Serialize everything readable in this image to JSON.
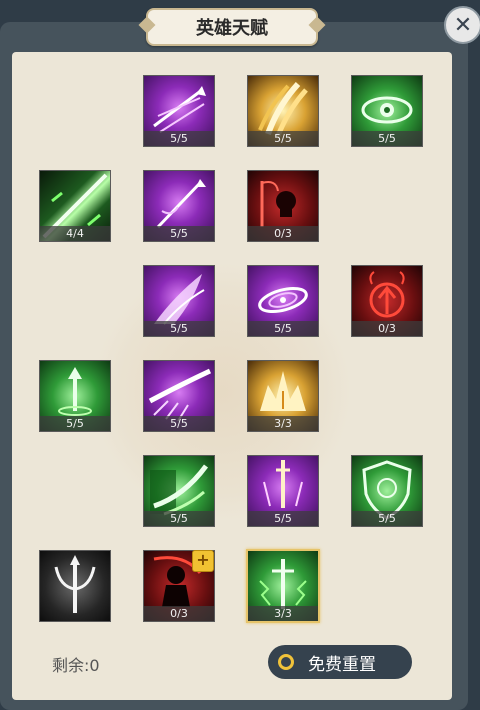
{
  "header": {
    "title": "英雄天赋"
  },
  "close_icon": "close-icon",
  "talents": [
    {
      "id": "arrows-volley",
      "count": "5/5",
      "color": "purple",
      "icon": "triple-arrow-icon"
    },
    {
      "id": "golden-claws",
      "count": "5/5",
      "color": "gold",
      "icon": "claw-slash-icon"
    },
    {
      "id": "green-eye",
      "count": "5/5",
      "color": "green",
      "icon": "eye-icon"
    },
    {
      "id": "green-blade-storm",
      "count": "4/4",
      "color": "green",
      "icon": "blade-storm-icon"
    },
    {
      "id": "spirit-arrow",
      "count": "5/5",
      "color": "purple",
      "icon": "spirit-arrow-icon"
    },
    {
      "id": "skull-sickle",
      "count": "0/3",
      "color": "red",
      "icon": "skull-sickle-icon"
    },
    {
      "id": "purple-wing",
      "count": "5/5",
      "color": "purple",
      "icon": "wing-icon"
    },
    {
      "id": "void-vortex",
      "count": "5/5",
      "color": "purple",
      "icon": "vortex-icon"
    },
    {
      "id": "demon-sigil",
      "count": "0/3",
      "color": "red",
      "icon": "demon-sigil-icon"
    },
    {
      "id": "nature-arrow",
      "count": "5/5",
      "color": "green",
      "icon": "ground-arrow-icon"
    },
    {
      "id": "purple-slash",
      "count": "5/5",
      "color": "purple",
      "icon": "slash-icon"
    },
    {
      "id": "golden-crown",
      "count": "3/3",
      "color": "gold",
      "icon": "crown-burst-icon"
    },
    {
      "id": "scale-claw",
      "count": "5/5",
      "color": "green",
      "icon": "scale-claw-icon"
    },
    {
      "id": "sword-rain",
      "count": "5/5",
      "color": "purple",
      "icon": "sword-rain-icon"
    },
    {
      "id": "leaf-shield",
      "count": "5/5",
      "color": "green",
      "icon": "shield-icon"
    },
    {
      "id": "trident-ward",
      "count": "",
      "color": "dark",
      "icon": "trident-icon"
    },
    {
      "id": "blood-reaper",
      "count": "0/3",
      "color": "red",
      "icon": "reaper-icon"
    },
    {
      "id": "thunder-sword",
      "count": "3/3",
      "color": "green",
      "icon": "thunder-sword-icon"
    }
  ],
  "upgrade_badge": "+",
  "footer": {
    "remaining_label": "剩余:0",
    "reset_label": "免费重置",
    "reset_icon": "coin-icon"
  }
}
